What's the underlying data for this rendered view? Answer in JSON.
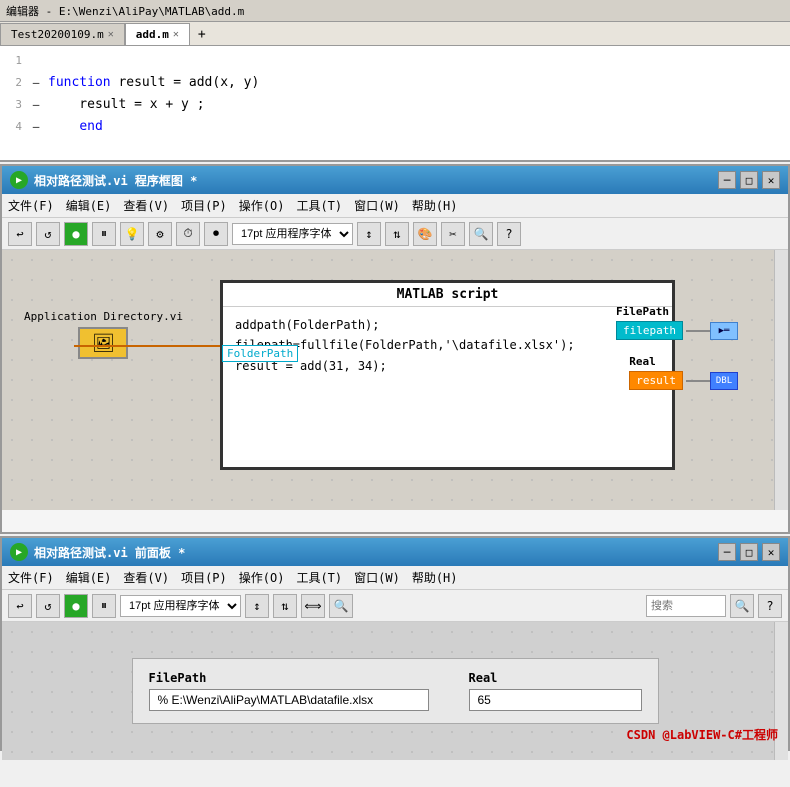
{
  "editor": {
    "title": "编辑器 - E:\\Wenzi\\AliPay\\MATLAB\\add.m",
    "tabs": [
      {
        "label": "Test20200109.m",
        "active": false
      },
      {
        "label": "add.m",
        "active": true
      }
    ],
    "add_tab": "+",
    "lines": [
      {
        "num": "1",
        "dash": "",
        "content": ""
      },
      {
        "num": "2",
        "dash": "—",
        "content": "function result = add(x, y)"
      },
      {
        "num": "3",
        "dash": "—",
        "content": "    result = x + y ;"
      },
      {
        "num": "4",
        "dash": "—",
        "content": "end"
      }
    ]
  },
  "block_diagram": {
    "title": "相对路径测试.vi 程序框图 *",
    "title_icon": "▶",
    "menu": [
      "文件(F)",
      "编辑(E)",
      "查看(V)",
      "项目(P)",
      "操作(O)",
      "工具(T)",
      "窗口(W)",
      "帮助(H)"
    ],
    "font_select": "17pt 应用程序字体",
    "matlab_script": {
      "title": "MATLAB script",
      "code": [
        "addpath(FolderPath);",
        "filepath=fullfile(FolderPath,'\\datafile.xlsx');",
        "result = add(31, 34);"
      ]
    },
    "app_dir": {
      "label": "Application Directory.vi",
      "icon": "🖼"
    },
    "folder_path": "FolderPath",
    "terminals": {
      "filepath": {
        "label": "FilePath",
        "box_label": "filepath",
        "type": "teal"
      },
      "result": {
        "label": "Real",
        "box_label": "result",
        "type": "orange",
        "arrow_label": "DBL"
      }
    }
  },
  "front_panel": {
    "title": "相对路径测试.vi 前面板 *",
    "title_icon": "▶",
    "menu": [
      "文件(F)",
      "编辑(E)",
      "查看(V)",
      "项目(P)",
      "操作(O)",
      "工具(T)",
      "窗口(W)",
      "帮助(H)"
    ],
    "font_select": "17pt 应用程序字体",
    "search_placeholder": "搜索",
    "fields": {
      "filepath": {
        "label": "FilePath",
        "value": "% E:\\Wenzi\\AliPay\\MATLAB\\datafile.xlsx"
      },
      "real": {
        "label": "Real",
        "value": "65"
      }
    }
  },
  "watermark": "CSDN @LabVIEW-C#工程师",
  "window_controls": {
    "minimize": "─",
    "maximize": "□",
    "close": "✕"
  }
}
